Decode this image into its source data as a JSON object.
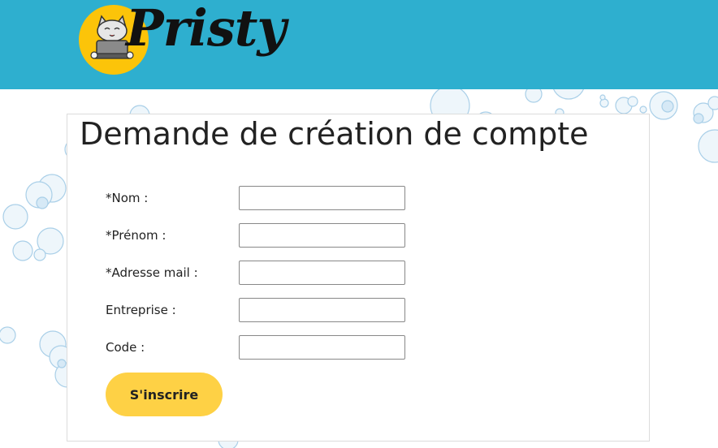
{
  "header": {
    "logo_text": "Pristy",
    "colors": {
      "header_bg": "#2eafcf",
      "logo_circle": "#fcc409",
      "button": "#fed145"
    }
  },
  "form": {
    "title": "Demande de création de compte",
    "fields": [
      {
        "label": "*Nom :",
        "value": ""
      },
      {
        "label": "*Prénom :",
        "value": ""
      },
      {
        "label": "*Adresse mail :",
        "value": ""
      },
      {
        "label": "Entreprise :",
        "value": ""
      },
      {
        "label": "Code :",
        "value": ""
      }
    ],
    "submit_label": "S'inscrire"
  },
  "icons": [
    "cat-laptop-logo-icon",
    "bubbles-background"
  ]
}
